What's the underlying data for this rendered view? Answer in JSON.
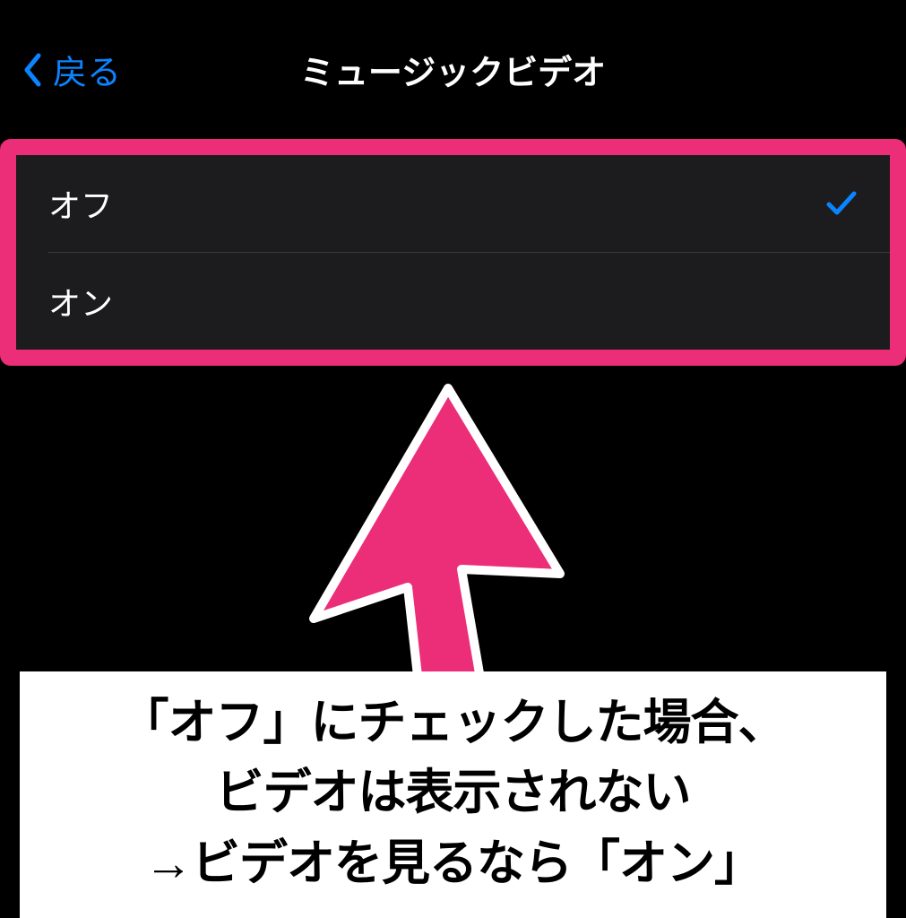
{
  "nav": {
    "back_label": "戻る",
    "title": "ミュージックビデオ"
  },
  "options": {
    "off_label": "オフ",
    "on_label": "オン",
    "selected": "off"
  },
  "colors": {
    "accent_blue": "#0a84ff",
    "highlight_pink": "#ec2d78"
  },
  "caption": {
    "line1": "「オフ」にチェックした場合、",
    "line2": "ビデオは表示されない",
    "line3": "→ビデオを見るなら「オン」"
  }
}
